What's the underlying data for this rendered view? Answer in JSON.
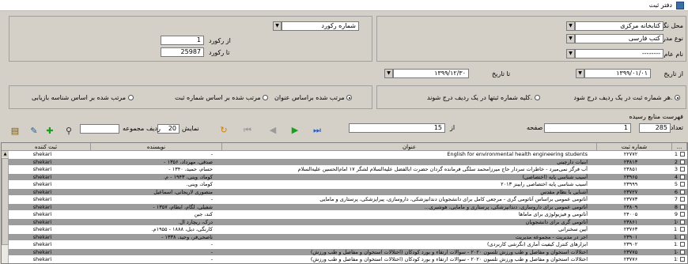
{
  "window": {
    "title": "دفتر ثبت"
  },
  "filters": {
    "location_label": "محل نگهداری",
    "location_value": "کتابخانه مرکزی",
    "doc_type_label": "نوع مدرک",
    "doc_type_value": "کتب فارسی",
    "material_label": "نام عام مواد",
    "material_value": "--------",
    "record_select": "شماره رکورد",
    "from_record_label": "از رکورد",
    "from_record_value": "1",
    "to_record_label": "تا رکورد",
    "to_record_value": "25987",
    "from_date_label": "از تاریخ",
    "from_date_value": "۱۳۹۹/۰۱/۰۱",
    "to_date_label": "تا تاریخ",
    "to_date_value": "۱۳۹۹/۱۲/۳۰"
  },
  "options": {
    "per_row": "هر شماره ثبت در یک ردیف درج شود.",
    "all_in_row": "کلیه شماره ثبتها در یک ردیف درج شوند.",
    "sort_title": "مرتب شده براساس عنوان",
    "sort_reg": "مرتب شده بر اساس شماره ثبت",
    "sort_retrieval": "مرتب شده بر اساس شناسه بازیابی"
  },
  "pager": {
    "list_label": "فهرست منابع رسیده",
    "count_label": "تعداد",
    "count_value": "285",
    "page_label": "صفحه",
    "page_value": "1",
    "of_label": "از",
    "of_value": "15",
    "show_label": "نمایش",
    "show_value": "20",
    "row_label": "ردیف",
    "group_label": "مجموعه"
  },
  "table": {
    "columns": [
      "...",
      "شماره ثبت",
      "عنوان",
      "نویسنده",
      "ثبت کننده"
    ],
    "rows": [
      {
        "n": "1",
        "reg": "۲۲۷۷۲",
        "title": "English for environmental health engineering students",
        "author": "-",
        "user": "shekari"
      },
      {
        "n": "2",
        "reg": "۲۳۸۱۳",
        "title": "ابنیات دارچینی",
        "author": "صدقی، مهرداد، ۱۳۵۶ -",
        "user": "shekari"
      },
      {
        "n": "3",
        "reg": "۲۳۸۵۱",
        "title": "آب فرگز نمی‌میرد - خاطرات سردار حاج میرزامحمد سلگی فرمانده گردان حضرت ابالفضل علیه‌السلام لشگر ۱۷ امام‌الحسین علیه‌السلام",
        "author": "حسام، حمید، ۱۳۴۰ -",
        "user": "shekari"
      },
      {
        "n": "4",
        "reg": "۲۳۹۶۵",
        "title": "آسیب شناسی پایه (اختصاصی)",
        "author": "کوماد، وینی، ۱۹۴۳ - م.",
        "user": "shekari"
      },
      {
        "n": "5",
        "reg": "۲۳۹۹۹",
        "title": "آسیب شناسی پایه اختصاصی رابینز ۲۰۱۳",
        "author": "کوماد، وینی.",
        "user": "shekari"
      },
      {
        "n": "6",
        "reg": "۲۳۷۲۷",
        "title": "آشنایی با نظام مقدس",
        "author": "منصوری لاریجانی، اسماعیل",
        "user": "shekari"
      },
      {
        "n": "7",
        "reg": "۲۳۷۷۳",
        "title": "آناتومی عمومی براساس آناتومی گری - مرجعی کامل برای دانشجویان دندانپزشکی، داروسازی، پیراپزشکی، پرستاری و مامایی",
        "author": "-",
        "user": "shekari"
      },
      {
        "n": "8",
        "reg": "۲۳۸۰۹",
        "title": "آناتومی عمومی برای داروسازی، دندانپزشکی، پرستاری و مامایی، هوشبری...",
        "author": "شفیلی، لگام، ابطام، ۱۳۵۷ -",
        "user": "shekari"
      },
      {
        "n": "9",
        "reg": "۲۴۰۰۵",
        "title": "آناتومی و فیزیولوژی برای ماماها",
        "author": "کند، جین",
        "user": "shekari"
      },
      {
        "n": "10",
        "reg": "۲۳۸۶۱",
        "title": "آناتومی گری برای دانشجویان",
        "author": "درک، ریچارد ال.",
        "user": "shekari"
      },
      {
        "n": "11",
        "reg": "۲۳۷۶۳",
        "title": "آیین سخنرانی",
        "author": "کارنگی، دیل، ۱۸۸۸ - ۱۹۵۵م.",
        "user": "shekari"
      },
      {
        "n": "12",
        "reg": "۲۳۹۰۱",
        "title": "اجر در مدیریت - مجموعه مدیریت",
        "author": "ناصحی‌فر، وحید، ۱۳۳۸ -",
        "user": "shekari"
      },
      {
        "n": "13",
        "reg": "۲۳۹۰۲",
        "title": "ابزارهای کنترل کیفیت آماری (نگرشی کاربردی)",
        "author": "-",
        "user": "shekari"
      },
      {
        "n": "14",
        "reg": "۲۳۷۷۵",
        "title": "اختلالات استخوان و مفاصل و طب ورزش تلسون ۲۰۲۰ - سوالات ارتقاء و بورد کودکان (اختلالات استخوان و مفاصل و طب ورزش)",
        "author": "-",
        "user": "shekari"
      },
      {
        "n": "15",
        "reg": "۲۳۷۷۶",
        "title": "اختلالات استخوان و مفاصل و طب ورزش تلسون ۲۰۲۰ - سوالات ارتقاء و بورد کودکان (اختلالات استخوان و مفاصل و طب ورزش)",
        "author": "-",
        "user": "shekari"
      }
    ]
  },
  "colors": {
    "alt_row": "#9c9c9c",
    "window_bg": "#d4d0c8"
  }
}
